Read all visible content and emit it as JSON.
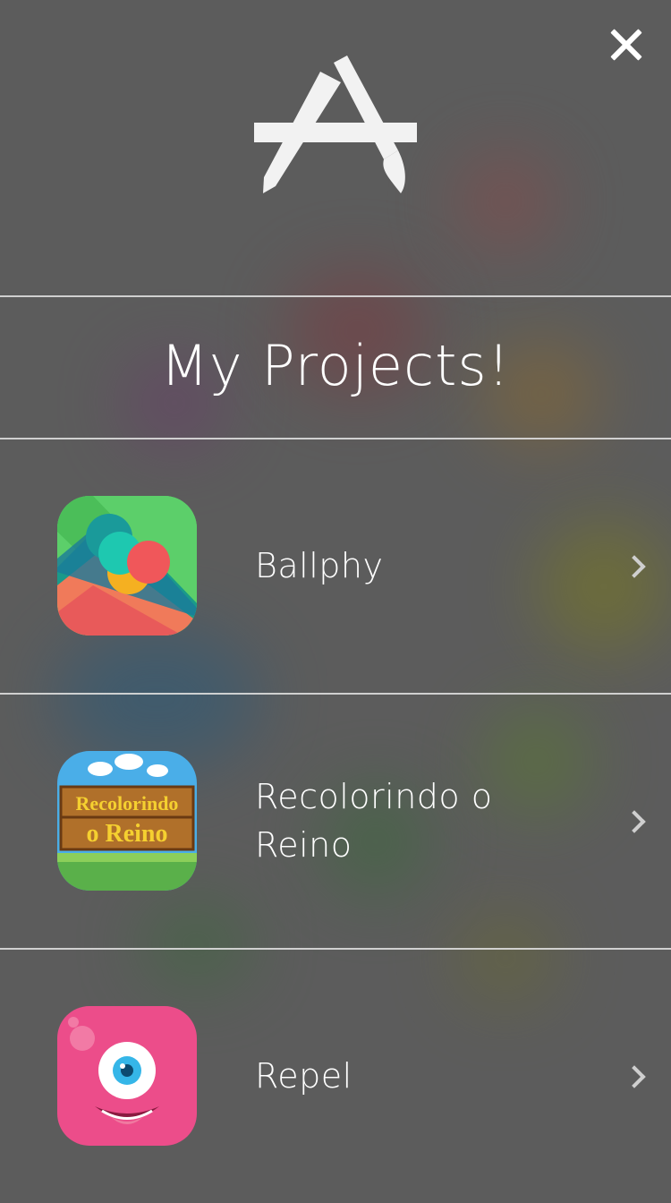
{
  "header": {
    "close_icon": "close-icon",
    "logo_icon": "app-store-logo-icon"
  },
  "title": "My Projects!",
  "colors": {
    "background": "#5c5c5c",
    "text": "#ffffff",
    "divider": "#dddddd",
    "chevron": "#cfcfcf"
  },
  "projects": [
    {
      "name": "Ballphy",
      "icon": "ballphy-app-icon"
    },
    {
      "name": "Recolorindo o Reino",
      "icon": "recolorindo-o-reino-app-icon",
      "icon_text": [
        "Recolorindo",
        "o Reino"
      ]
    },
    {
      "name": "Repel",
      "icon": "repel-app-icon"
    }
  ]
}
